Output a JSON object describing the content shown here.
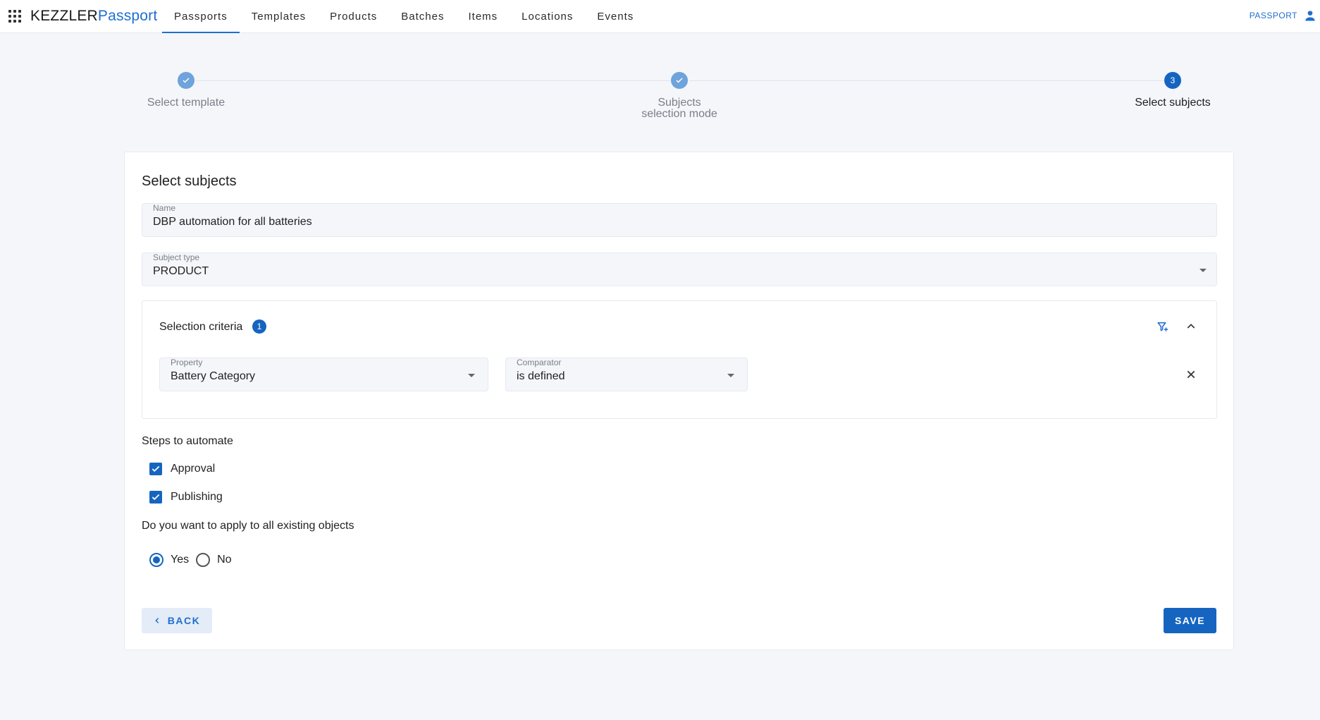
{
  "header": {
    "brand_part1": "KEZZLER",
    "brand_part2": "Passport",
    "nav": [
      "Passports",
      "Templates",
      "Products",
      "Batches",
      "Items",
      "Locations",
      "Events"
    ],
    "active_nav": "Passports",
    "user_label": "PASSPORT",
    "accent_color": "#1e6fcf"
  },
  "stepper": {
    "steps": [
      {
        "label": "Select template",
        "status": "done",
        "icon": "check-icon"
      },
      {
        "label_line1": "Subjects",
        "label_line2": "selection mode",
        "status": "done",
        "icon": "check-icon"
      },
      {
        "label": "Select subjects",
        "status": "current",
        "number": "3"
      }
    ]
  },
  "form": {
    "title": "Select subjects",
    "name_label": "Name",
    "name_value": "DBP automation for all batteries",
    "subject_type_label": "Subject type",
    "subject_type_value": "PRODUCT",
    "criteria": {
      "title": "Selection criteria",
      "count": "1",
      "property_label": "Property",
      "property_value": "Battery Category",
      "comparator_label": "Comparator",
      "comparator_value": "is defined"
    },
    "steps_label": "Steps to automate",
    "steps": [
      {
        "label": "Approval",
        "checked": true
      },
      {
        "label": "Publishing",
        "checked": true
      }
    ],
    "apply_question": "Do you want to apply to all existing objects",
    "apply_options": [
      {
        "label": "Yes",
        "selected": true
      },
      {
        "label": "No",
        "selected": false
      }
    ],
    "back_label": "BACK",
    "save_label": "SAVE"
  }
}
